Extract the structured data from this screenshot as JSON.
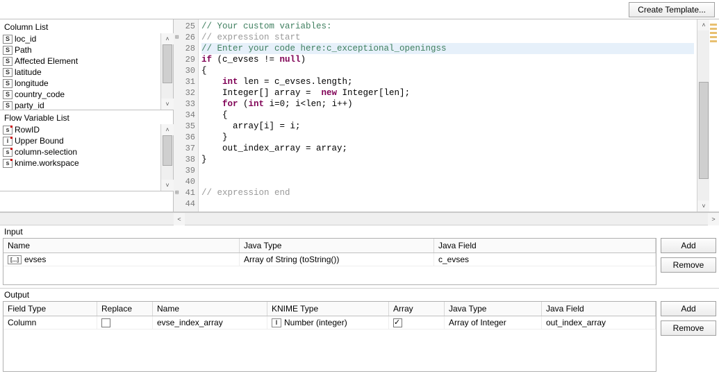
{
  "topbar": {
    "create_template": "Create Template..."
  },
  "column_list": {
    "title": "Column List",
    "items": [
      {
        "badge": "S",
        "label": "loc_id"
      },
      {
        "badge": "S",
        "label": "Path"
      },
      {
        "badge": "S",
        "label": "Affected Element"
      },
      {
        "badge": "S",
        "label": "latitude"
      },
      {
        "badge": "S",
        "label": "longitude"
      },
      {
        "badge": "S",
        "label": "country_code"
      },
      {
        "badge": "S",
        "label": "party_id"
      }
    ]
  },
  "flow_var_list": {
    "title": "Flow Variable List",
    "items": [
      {
        "badge": "s",
        "label": "RowID"
      },
      {
        "badge": "i",
        "label": "Upper Bound"
      },
      {
        "badge": "s",
        "label": "column-selection"
      },
      {
        "badge": "s",
        "label": "knime.workspace"
      }
    ]
  },
  "editor": {
    "gutter_start": 25,
    "lines": [
      {
        "n": 25,
        "cls": "cm",
        "txt": "// Your custom variables:"
      },
      {
        "n": 26,
        "cls": "cm-gray",
        "txt": "// expression start",
        "fold": true
      },
      {
        "n": 28,
        "cls": "cm",
        "txt": "// Enter your code here:c_exceptional_openingss",
        "hl": true
      },
      {
        "n": 29,
        "html": "<span class='kw'>if</span> (c_evses != <span class='kw'>null</span>)"
      },
      {
        "n": 30,
        "txt": "{"
      },
      {
        "n": 31,
        "html": "    <span class='kw'>int</span> len = c_evses.length;"
      },
      {
        "n": 32,
        "html": "    Integer[] array =  <span class='kw'>new</span> Integer[len];"
      },
      {
        "n": 33,
        "html": "    <span class='kw'>for</span> (<span class='kw'>int</span> i=0; i&lt;len; i++)"
      },
      {
        "n": 34,
        "txt": "    {"
      },
      {
        "n": 35,
        "txt": "      array[i] = i;"
      },
      {
        "n": 36,
        "txt": "    }"
      },
      {
        "n": 37,
        "txt": "    out_index_array = array;"
      },
      {
        "n": 38,
        "txt": "}"
      },
      {
        "n": 39,
        "txt": ""
      },
      {
        "n": 40,
        "txt": ""
      },
      {
        "n": 41,
        "cls": "cm-gray",
        "txt": "// expression end",
        "fold": true
      },
      {
        "n": 44,
        "txt": ""
      }
    ]
  },
  "input_section": {
    "title": "Input",
    "headers": {
      "name": "Name",
      "type": "Java Type",
      "field": "Java Field"
    },
    "row": {
      "badge": "[...]",
      "name": "evses",
      "type": "Array of String (toString())",
      "field": "c_evses"
    },
    "add": "Add",
    "remove": "Remove"
  },
  "output_section": {
    "title": "Output",
    "headers": {
      "ftype": "Field Type",
      "replace": "Replace",
      "name": "Name",
      "ktype": "KNIME Type",
      "array": "Array",
      "jtype": "Java Type",
      "jfield": "Java Field"
    },
    "row": {
      "ftype": "Column",
      "replace": false,
      "name": "evse_index_array",
      "ktype_badge": "I",
      "ktype": "Number (integer)",
      "array": true,
      "jtype": "Array of Integer",
      "jfield": "out_index_array"
    },
    "add": "Add",
    "remove": "Remove"
  }
}
